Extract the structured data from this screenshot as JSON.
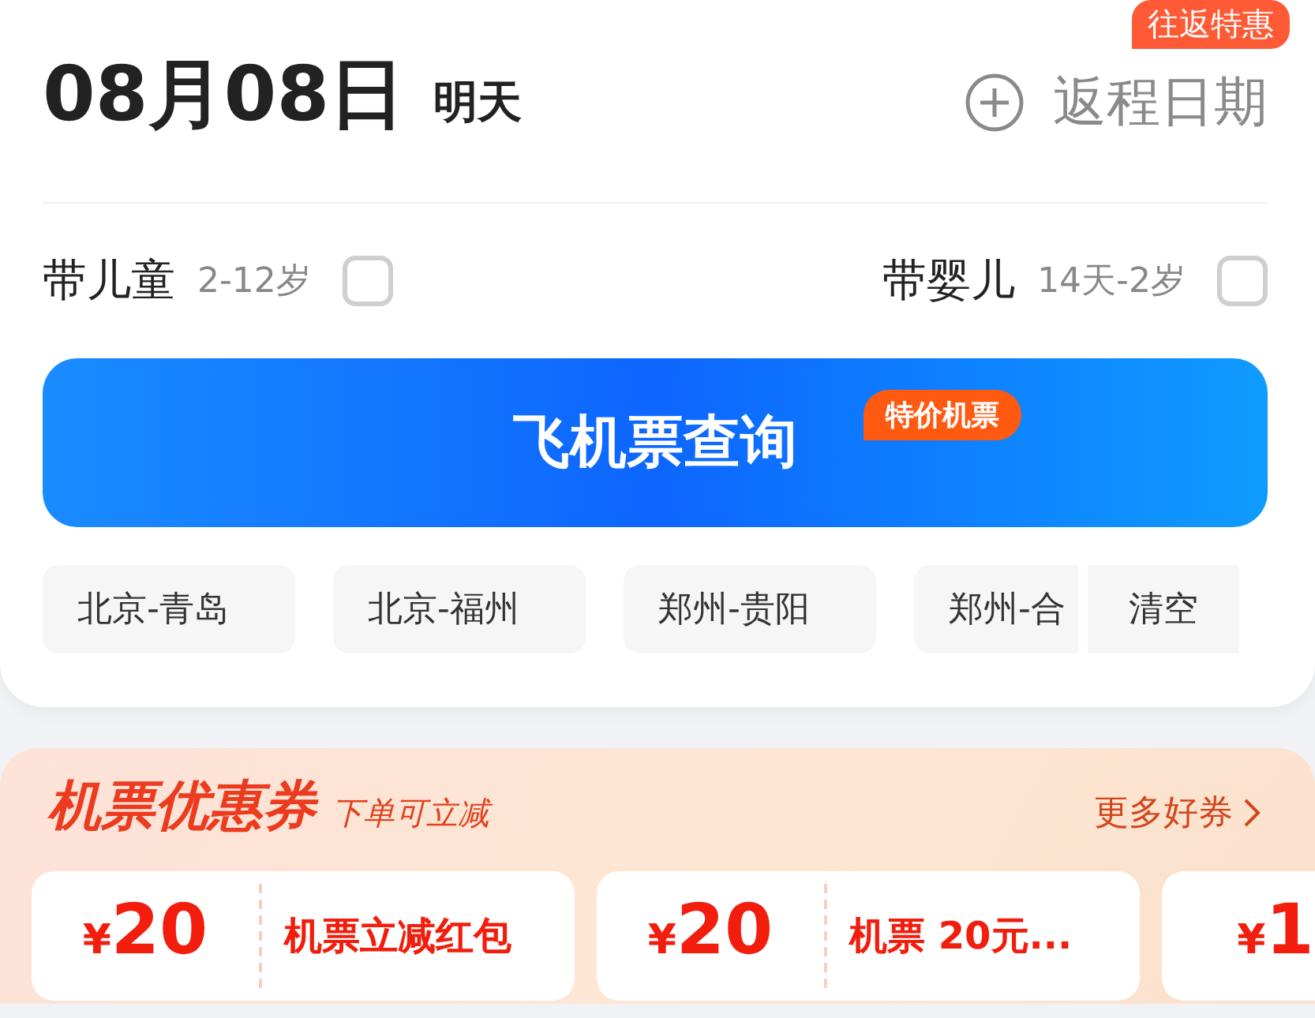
{
  "trip": {
    "date": "08月08日",
    "day_hint": "明天",
    "return_label": "返程日期",
    "return_badge": "往返特惠"
  },
  "passengers": [
    {
      "label": "带儿童",
      "age": "2-12岁",
      "checked": false
    },
    {
      "label": "带婴儿",
      "age": "14天-2岁",
      "checked": false
    }
  ],
  "search": {
    "label": "飞机票查询",
    "badge": "特价机票"
  },
  "history": {
    "routes": [
      "北京-青岛",
      "北京-福州",
      "郑州-贵阳",
      "郑州-合"
    ],
    "clear": "清空"
  },
  "coupons": {
    "title": "机票优惠券",
    "subtitle": "下单可立减",
    "more": "更多好券",
    "items": [
      {
        "currency": "¥",
        "amount": "20",
        "name": "机票立减红包"
      },
      {
        "currency": "¥",
        "amount": "20",
        "name": "机票 20元..."
      },
      {
        "currency": "¥",
        "amount": "1"
      }
    ]
  }
}
